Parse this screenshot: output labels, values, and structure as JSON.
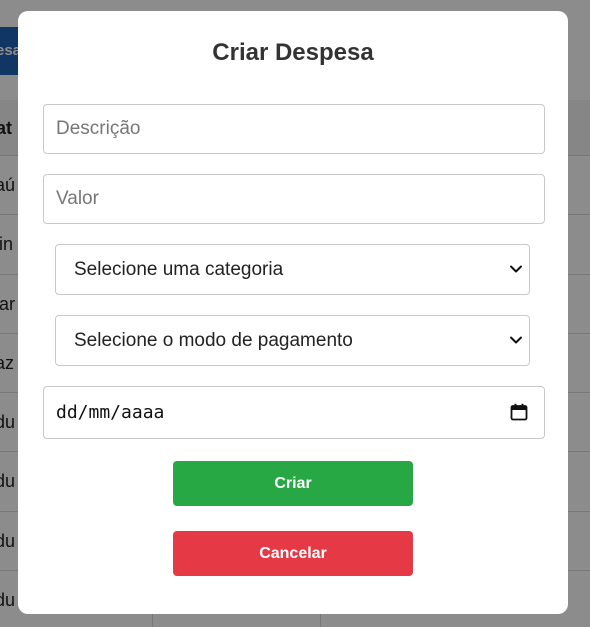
{
  "background": {
    "button_label": "esa",
    "table_header": "at",
    "rows": [
      "aú",
      "lin",
      "rar",
      "az",
      "du",
      "du",
      "du",
      "du"
    ]
  },
  "modal": {
    "title": "Criar Despesa",
    "description": {
      "placeholder": "Descrição",
      "value": ""
    },
    "valor": {
      "placeholder": "Valor",
      "value": ""
    },
    "category_select": {
      "selected": "Selecione uma categoria"
    },
    "payment_select": {
      "selected": "Selecione o modo de pagamento"
    },
    "date_input": {
      "display": "dd/mm/aaaa"
    },
    "create_button": "Criar",
    "cancel_button": "Cancelar"
  },
  "colors": {
    "create": "#28a745",
    "cancel": "#e63946",
    "background_button": "#1e63b8"
  },
  "icons": {
    "select_arrow": "chevron-down-icon",
    "date_picker": "calendar-icon"
  }
}
